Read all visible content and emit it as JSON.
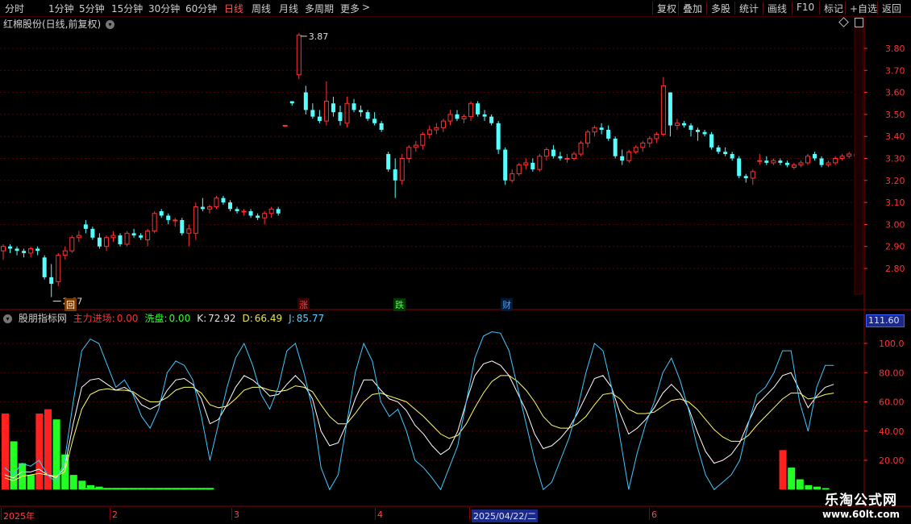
{
  "toolbar": {
    "left_items": [
      "分时",
      "1分钟",
      "5分钟",
      "15分钟",
      "30分钟",
      "60分钟",
      "日线",
      "周线",
      "月线",
      "多周期",
      "更多"
    ],
    "active": "日线",
    "more_chevron": ">",
    "right_items": [
      "复权",
      "叠加",
      "多股",
      "统计",
      "画线",
      "F10",
      "标记",
      "+自选",
      "返回"
    ]
  },
  "price_pane": {
    "title": "红棉股份(日线,前复权)",
    "y_ticks": [
      "3.80",
      "3.70",
      "3.60",
      "3.50",
      "3.40",
      "3.30",
      "3.20",
      "3.10",
      "3.00",
      "2.90",
      "2.80"
    ],
    "high_label": "3.87",
    "low_label": "2.67",
    "markers": [
      {
        "text": "回",
        "color": "#ffffff",
        "bg": "#7a3a00"
      },
      {
        "text": "涨",
        "color": "#ff4040",
        "bg": "#3a0000"
      },
      {
        "text": "跌",
        "color": "#40ff40",
        "bg": "#003a00"
      },
      {
        "text": "财",
        "color": "#40a0ff",
        "bg": "#001a3a"
      }
    ]
  },
  "indicator_pane": {
    "name": "股朋指标网",
    "fields": [
      {
        "label": "主力进场:",
        "value": "0.00",
        "color": "#ff3030"
      },
      {
        "label": "洗盘:",
        "value": "0.00",
        "color": "#30ff30"
      },
      {
        "label": "K:",
        "value": "72.92",
        "color": "#e0e0e0"
      },
      {
        "label": "D:",
        "value": "66.49",
        "color": "#e6e64d"
      },
      {
        "label": "J:",
        "value": "85.77",
        "color": "#55d0ff"
      }
    ],
    "y_ticks": [
      "100.0",
      "80.00",
      "60.00",
      "40.00",
      "20.00"
    ],
    "current_box": "111.60"
  },
  "date_axis": {
    "labels": [
      "2025年",
      "2",
      "3",
      "4",
      "2025/04/22/二",
      "6"
    ]
  },
  "watermark": {
    "line1": "乐淘公式网",
    "line2": "www.60lt.com"
  },
  "colors": {
    "up": "#ff3232",
    "down": "#54ffff",
    "k": "#ffffff",
    "d": "#ffff66",
    "j": "#40c8ff",
    "axis": "#ff3232",
    "grid": "#5a0000"
  },
  "chart_data": {
    "type": "candlestick",
    "candles": [
      {
        "o": 2.88,
        "h": 2.91,
        "l": 2.84,
        "c": 2.9
      },
      {
        "o": 2.9,
        "h": 2.91,
        "l": 2.87,
        "c": 2.89
      },
      {
        "o": 2.89,
        "h": 2.9,
        "l": 2.86,
        "c": 2.88
      },
      {
        "o": 2.88,
        "h": 2.89,
        "l": 2.85,
        "c": 2.87
      },
      {
        "o": 2.87,
        "h": 2.9,
        "l": 2.85,
        "c": 2.89
      },
      {
        "o": 2.89,
        "h": 2.9,
        "l": 2.86,
        "c": 2.88
      },
      {
        "o": 2.85,
        "h": 2.86,
        "l": 2.75,
        "c": 2.76
      },
      {
        "o": 2.76,
        "h": 2.82,
        "l": 2.67,
        "c": 2.73
      },
      {
        "o": 2.74,
        "h": 2.87,
        "l": 2.72,
        "c": 2.86
      },
      {
        "o": 2.86,
        "h": 2.9,
        "l": 2.84,
        "c": 2.88
      },
      {
        "o": 2.88,
        "h": 2.95,
        "l": 2.87,
        "c": 2.94
      },
      {
        "o": 2.94,
        "h": 2.97,
        "l": 2.92,
        "c": 2.95
      },
      {
        "o": 3.0,
        "h": 3.02,
        "l": 2.96,
        "c": 2.98
      },
      {
        "o": 2.98,
        "h": 2.99,
        "l": 2.93,
        "c": 2.94
      },
      {
        "o": 2.94,
        "h": 2.96,
        "l": 2.89,
        "c": 2.9
      },
      {
        "o": 2.9,
        "h": 2.95,
        "l": 2.88,
        "c": 2.94
      },
      {
        "o": 2.94,
        "h": 2.97,
        "l": 2.92,
        "c": 2.95
      },
      {
        "o": 2.95,
        "h": 2.96,
        "l": 2.9,
        "c": 2.91
      },
      {
        "o": 2.91,
        "h": 2.97,
        "l": 2.9,
        "c": 2.96
      },
      {
        "o": 2.96,
        "h": 2.98,
        "l": 2.94,
        "c": 2.95
      },
      {
        "o": 2.95,
        "h": 2.96,
        "l": 2.93,
        "c": 2.94
      },
      {
        "o": 2.93,
        "h": 2.98,
        "l": 2.9,
        "c": 2.97
      },
      {
        "o": 2.97,
        "h": 3.06,
        "l": 2.96,
        "c": 3.05
      },
      {
        "o": 3.06,
        "h": 3.07,
        "l": 3.03,
        "c": 3.04
      },
      {
        "o": 3.04,
        "h": 3.05,
        "l": 3.0,
        "c": 3.02
      },
      {
        "o": 3.02,
        "h": 3.03,
        "l": 2.99,
        "c": 3.02
      },
      {
        "o": 3.02,
        "h": 3.03,
        "l": 2.95,
        "c": 2.96
      },
      {
        "o": 2.96,
        "h": 3.0,
        "l": 2.9,
        "c": 2.98
      },
      {
        "o": 2.96,
        "h": 3.1,
        "l": 2.93,
        "c": 3.08
      },
      {
        "o": 3.08,
        "h": 3.12,
        "l": 3.06,
        "c": 3.07
      },
      {
        "o": 3.07,
        "h": 3.09,
        "l": 3.05,
        "c": 3.08
      },
      {
        "o": 3.08,
        "h": 3.13,
        "l": 3.07,
        "c": 3.12
      },
      {
        "o": 3.12,
        "h": 3.13,
        "l": 3.09,
        "c": 3.1
      },
      {
        "o": 3.1,
        "h": 3.11,
        "l": 3.06,
        "c": 3.07
      },
      {
        "o": 3.07,
        "h": 3.08,
        "l": 3.05,
        "c": 3.06
      },
      {
        "o": 3.06,
        "h": 3.07,
        "l": 3.04,
        "c": 3.06
      },
      {
        "o": 3.06,
        "h": 3.07,
        "l": 3.03,
        "c": 3.04
      },
      {
        "o": 3.04,
        "h": 3.05,
        "l": 3.02,
        "c": 3.03
      },
      {
        "o": 3.03,
        "h": 3.06,
        "l": 3.0,
        "c": 3.05
      },
      {
        "o": 3.05,
        "h": 3.08,
        "l": 3.03,
        "c": 3.07
      },
      {
        "o": 3.07,
        "h": 3.08,
        "l": 3.04,
        "c": 3.05
      },
      {
        "o": 3.45,
        "h": 3.45,
        "l": 3.45,
        "c": 3.45
      },
      {
        "o": 3.56,
        "h": 3.56,
        "l": 3.54,
        "c": 3.55
      },
      {
        "o": 3.68,
        "h": 3.87,
        "l": 3.66,
        "c": 3.86
      },
      {
        "o": 3.6,
        "h": 3.63,
        "l": 3.5,
        "c": 3.52
      },
      {
        "o": 3.52,
        "h": 3.55,
        "l": 3.48,
        "c": 3.49
      },
      {
        "o": 3.49,
        "h": 3.52,
        "l": 3.46,
        "c": 3.47
      },
      {
        "o": 3.47,
        "h": 3.65,
        "l": 3.45,
        "c": 3.56
      },
      {
        "o": 3.55,
        "h": 3.58,
        "l": 3.49,
        "c": 3.51
      },
      {
        "o": 3.51,
        "h": 3.54,
        "l": 3.45,
        "c": 3.47
      },
      {
        "o": 3.46,
        "h": 3.58,
        "l": 3.44,
        "c": 3.55
      },
      {
        "o": 3.55,
        "h": 3.57,
        "l": 3.51,
        "c": 3.52
      },
      {
        "o": 3.52,
        "h": 3.54,
        "l": 3.49,
        "c": 3.51
      },
      {
        "o": 3.51,
        "h": 3.52,
        "l": 3.47,
        "c": 3.48
      },
      {
        "o": 3.48,
        "h": 3.51,
        "l": 3.45,
        "c": 3.46
      },
      {
        "o": 3.46,
        "h": 3.47,
        "l": 3.42,
        "c": 3.43
      },
      {
        "o": 3.32,
        "h": 3.33,
        "l": 3.24,
        "c": 3.25
      },
      {
        "o": 3.25,
        "h": 3.3,
        "l": 3.12,
        "c": 3.2
      },
      {
        "o": 3.2,
        "h": 3.32,
        "l": 3.18,
        "c": 3.3
      },
      {
        "o": 3.3,
        "h": 3.36,
        "l": 3.28,
        "c": 3.35
      },
      {
        "o": 3.35,
        "h": 3.38,
        "l": 3.33,
        "c": 3.36
      },
      {
        "o": 3.36,
        "h": 3.42,
        "l": 3.34,
        "c": 3.41
      },
      {
        "o": 3.41,
        "h": 3.45,
        "l": 3.39,
        "c": 3.43
      },
      {
        "o": 3.43,
        "h": 3.46,
        "l": 3.41,
        "c": 3.44
      },
      {
        "o": 3.44,
        "h": 3.48,
        "l": 3.42,
        "c": 3.47
      },
      {
        "o": 3.47,
        "h": 3.52,
        "l": 3.45,
        "c": 3.5
      },
      {
        "o": 3.5,
        "h": 3.52,
        "l": 3.47,
        "c": 3.48
      },
      {
        "o": 3.48,
        "h": 3.5,
        "l": 3.46,
        "c": 3.49
      },
      {
        "o": 3.49,
        "h": 3.56,
        "l": 3.47,
        "c": 3.55
      },
      {
        "o": 3.55,
        "h": 3.56,
        "l": 3.49,
        "c": 3.5
      },
      {
        "o": 3.5,
        "h": 3.52,
        "l": 3.47,
        "c": 3.49
      },
      {
        "o": 3.49,
        "h": 3.5,
        "l": 3.45,
        "c": 3.46
      },
      {
        "o": 3.46,
        "h": 3.47,
        "l": 3.32,
        "c": 3.34
      },
      {
        "o": 3.34,
        "h": 3.35,
        "l": 3.18,
        "c": 3.2
      },
      {
        "o": 3.2,
        "h": 3.25,
        "l": 3.19,
        "c": 3.23
      },
      {
        "o": 3.23,
        "h": 3.28,
        "l": 3.22,
        "c": 3.27
      },
      {
        "o": 3.27,
        "h": 3.3,
        "l": 3.25,
        "c": 3.28
      },
      {
        "o": 3.28,
        "h": 3.3,
        "l": 3.24,
        "c": 3.25
      },
      {
        "o": 3.25,
        "h": 3.32,
        "l": 3.24,
        "c": 3.31
      },
      {
        "o": 3.31,
        "h": 3.35,
        "l": 3.29,
        "c": 3.34
      },
      {
        "o": 3.34,
        "h": 3.36,
        "l": 3.3,
        "c": 3.31
      },
      {
        "o": 3.31,
        "h": 3.33,
        "l": 3.29,
        "c": 3.3
      },
      {
        "o": 3.3,
        "h": 3.32,
        "l": 3.28,
        "c": 3.3
      },
      {
        "o": 3.3,
        "h": 3.33,
        "l": 3.29,
        "c": 3.32
      },
      {
        "o": 3.32,
        "h": 3.38,
        "l": 3.31,
        "c": 3.37
      },
      {
        "o": 3.37,
        "h": 3.43,
        "l": 3.35,
        "c": 3.42
      },
      {
        "o": 3.42,
        "h": 3.45,
        "l": 3.4,
        "c": 3.44
      },
      {
        "o": 3.44,
        "h": 3.46,
        "l": 3.41,
        "c": 3.43
      },
      {
        "o": 3.43,
        "h": 3.45,
        "l": 3.38,
        "c": 3.39
      },
      {
        "o": 3.39,
        "h": 3.4,
        "l": 3.3,
        "c": 3.31
      },
      {
        "o": 3.31,
        "h": 3.34,
        "l": 3.27,
        "c": 3.29
      },
      {
        "o": 3.29,
        "h": 3.34,
        "l": 3.28,
        "c": 3.33
      },
      {
        "o": 3.33,
        "h": 3.36,
        "l": 3.32,
        "c": 3.35
      },
      {
        "o": 3.35,
        "h": 3.38,
        "l": 3.33,
        "c": 3.37
      },
      {
        "o": 3.37,
        "h": 3.4,
        "l": 3.35,
        "c": 3.39
      },
      {
        "o": 3.39,
        "h": 3.42,
        "l": 3.37,
        "c": 3.41
      },
      {
        "o": 3.41,
        "h": 3.67,
        "l": 3.4,
        "c": 3.63
      },
      {
        "o": 3.6,
        "h": 3.6,
        "l": 3.4,
        "c": 3.45
      },
      {
        "o": 3.45,
        "h": 3.48,
        "l": 3.43,
        "c": 3.46
      },
      {
        "o": 3.46,
        "h": 3.47,
        "l": 3.44,
        "c": 3.45
      },
      {
        "o": 3.45,
        "h": 3.46,
        "l": 3.4,
        "c": 3.43
      },
      {
        "o": 3.43,
        "h": 3.44,
        "l": 3.38,
        "c": 3.42
      },
      {
        "o": 3.42,
        "h": 3.43,
        "l": 3.4,
        "c": 3.41
      },
      {
        "o": 3.41,
        "h": 3.42,
        "l": 3.34,
        "c": 3.35
      },
      {
        "o": 3.35,
        "h": 3.36,
        "l": 3.32,
        "c": 3.33
      },
      {
        "o": 3.33,
        "h": 3.35,
        "l": 3.31,
        "c": 3.32
      },
      {
        "o": 3.32,
        "h": 3.33,
        "l": 3.29,
        "c": 3.3
      },
      {
        "o": 3.3,
        "h": 3.31,
        "l": 3.21,
        "c": 3.22
      },
      {
        "o": 3.22,
        "h": 3.23,
        "l": 3.19,
        "c": 3.21
      },
      {
        "o": 3.21,
        "h": 3.25,
        "l": 3.18,
        "c": 3.24
      },
      {
        "o": 3.29,
        "h": 3.32,
        "l": 3.27,
        "c": 3.29
      },
      {
        "o": 3.29,
        "h": 3.31,
        "l": 3.27,
        "c": 3.28
      },
      {
        "o": 3.28,
        "h": 3.3,
        "l": 3.27,
        "c": 3.29
      },
      {
        "o": 3.29,
        "h": 3.3,
        "l": 3.27,
        "c": 3.28
      },
      {
        "o": 3.28,
        "h": 3.29,
        "l": 3.26,
        "c": 3.27
      },
      {
        "o": 3.26,
        "h": 3.28,
        "l": 3.25,
        "c": 3.27
      },
      {
        "o": 3.27,
        "h": 3.29,
        "l": 3.26,
        "c": 3.28
      },
      {
        "o": 3.28,
        "h": 3.32,
        "l": 3.27,
        "c": 3.31
      },
      {
        "o": 3.32,
        "h": 3.33,
        "l": 3.29,
        "c": 3.3
      },
      {
        "o": 3.3,
        "h": 3.31,
        "l": 3.26,
        "c": 3.27
      },
      {
        "o": 3.27,
        "h": 3.29,
        "l": 3.26,
        "c": 3.28
      },
      {
        "o": 3.28,
        "h": 3.31,
        "l": 3.27,
        "c": 3.3
      },
      {
        "o": 3.3,
        "h": 3.32,
        "l": 3.29,
        "c": 3.31
      },
      {
        "o": 3.31,
        "h": 3.33,
        "l": 3.3,
        "c": 3.32
      },
      {
        "o": 3.32,
        "h": 3.33,
        "l": 3.3,
        "c": 3.31
      }
    ],
    "price_range": [
      2.67,
      3.87
    ],
    "indicator": {
      "range": [
        0,
        111.6
      ],
      "J": [
        15,
        10,
        18,
        16,
        20,
        10,
        5,
        20,
        60,
        95,
        103,
        100,
        85,
        70,
        75,
        65,
        50,
        42,
        55,
        80,
        88,
        85,
        75,
        50,
        20,
        45,
        70,
        90,
        100,
        85,
        65,
        55,
        70,
        95,
        100,
        80,
        55,
        15,
        0,
        10,
        45,
        80,
        100,
        88,
        60,
        50,
        55,
        40,
        20,
        15,
        8,
        0,
        15,
        30,
        60,
        90,
        105,
        108,
        107,
        95,
        70,
        45,
        20,
        0,
        5,
        20,
        35,
        55,
        80,
        100,
        95,
        70,
        35,
        0,
        25,
        45,
        60,
        80,
        90,
        75,
        55,
        30,
        10,
        0,
        5,
        10,
        20,
        45,
        65,
        70,
        80,
        95,
        95,
        60,
        40,
        70,
        85,
        85
      ],
      "K": [
        10,
        8,
        12,
        12,
        14,
        10,
        8,
        15,
        45,
        70,
        75,
        76,
        72,
        68,
        70,
        66,
        58,
        55,
        58,
        68,
        75,
        76,
        72,
        62,
        45,
        48,
        58,
        70,
        78,
        75,
        70,
        64,
        65,
        72,
        78,
        72,
        62,
        40,
        30,
        32,
        45,
        62,
        75,
        75,
        68,
        62,
        60,
        54,
        44,
        38,
        30,
        24,
        28,
        40,
        60,
        78,
        86,
        88,
        85,
        78,
        66,
        54,
        38,
        28,
        30,
        35,
        42,
        52,
        64,
        76,
        78,
        70,
        52,
        38,
        42,
        48,
        56,
        66,
        72,
        66,
        56,
        40,
        26,
        18,
        20,
        24,
        32,
        46,
        58,
        64,
        70,
        78,
        80,
        68,
        56,
        64,
        70,
        72
      ],
      "D": [
        8,
        6,
        9,
        10,
        11,
        10,
        9,
        12,
        35,
        55,
        65,
        68,
        69,
        68,
        68,
        67,
        63,
        60,
        60,
        63,
        68,
        70,
        70,
        66,
        58,
        56,
        57,
        62,
        68,
        70,
        70,
        68,
        67,
        68,
        71,
        70,
        67,
        58,
        50,
        45,
        45,
        52,
        60,
        65,
        66,
        64,
        62,
        60,
        55,
        50,
        44,
        38,
        35,
        37,
        45,
        56,
        66,
        74,
        78,
        78,
        74,
        68,
        60,
        50,
        44,
        42,
        42,
        45,
        50,
        58,
        65,
        66,
        62,
        55,
        52,
        52,
        53,
        57,
        61,
        62,
        60,
        55,
        48,
        41,
        36,
        33,
        33,
        37,
        44,
        50,
        56,
        62,
        66,
        66,
        62,
        63,
        65,
        66
      ],
      "zhuli_bars": [
        {
          "i": 0,
          "v": 52
        },
        {
          "i": 4,
          "v": 52
        },
        {
          "i": 5,
          "v": 55
        },
        {
          "i": 91,
          "v": 27
        }
      ],
      "xipan_bars": [
        {
          "i": 1,
          "v": 33
        },
        {
          "i": 2,
          "v": 18
        },
        {
          "i": 3,
          "v": 10
        },
        {
          "i": 5,
          "v": 18
        },
        {
          "i": 6,
          "v": 48
        },
        {
          "i": 7,
          "v": 24
        },
        {
          "i": 8,
          "v": 10
        },
        {
          "i": 9,
          "v": 6
        },
        {
          "i": 10,
          "v": 3
        },
        {
          "i": 11,
          "v": 2
        },
        {
          "i": 12,
          "v": 1
        },
        {
          "i": 13,
          "v": 1
        },
        {
          "i": 14,
          "v": 1
        },
        {
          "i": 15,
          "v": 1
        },
        {
          "i": 16,
          "v": 1
        },
        {
          "i": 17,
          "v": 1
        },
        {
          "i": 18,
          "v": 1
        },
        {
          "i": 19,
          "v": 1
        },
        {
          "i": 20,
          "v": 1
        },
        {
          "i": 21,
          "v": 1
        },
        {
          "i": 22,
          "v": 1
        },
        {
          "i": 23,
          "v": 1
        },
        {
          "i": 24,
          "v": 1
        },
        {
          "i": 92,
          "v": 15
        },
        {
          "i": 93,
          "v": 7
        },
        {
          "i": 94,
          "v": 3
        },
        {
          "i": 95,
          "v": 2
        },
        {
          "i": 96,
          "v": 1
        }
      ]
    }
  }
}
